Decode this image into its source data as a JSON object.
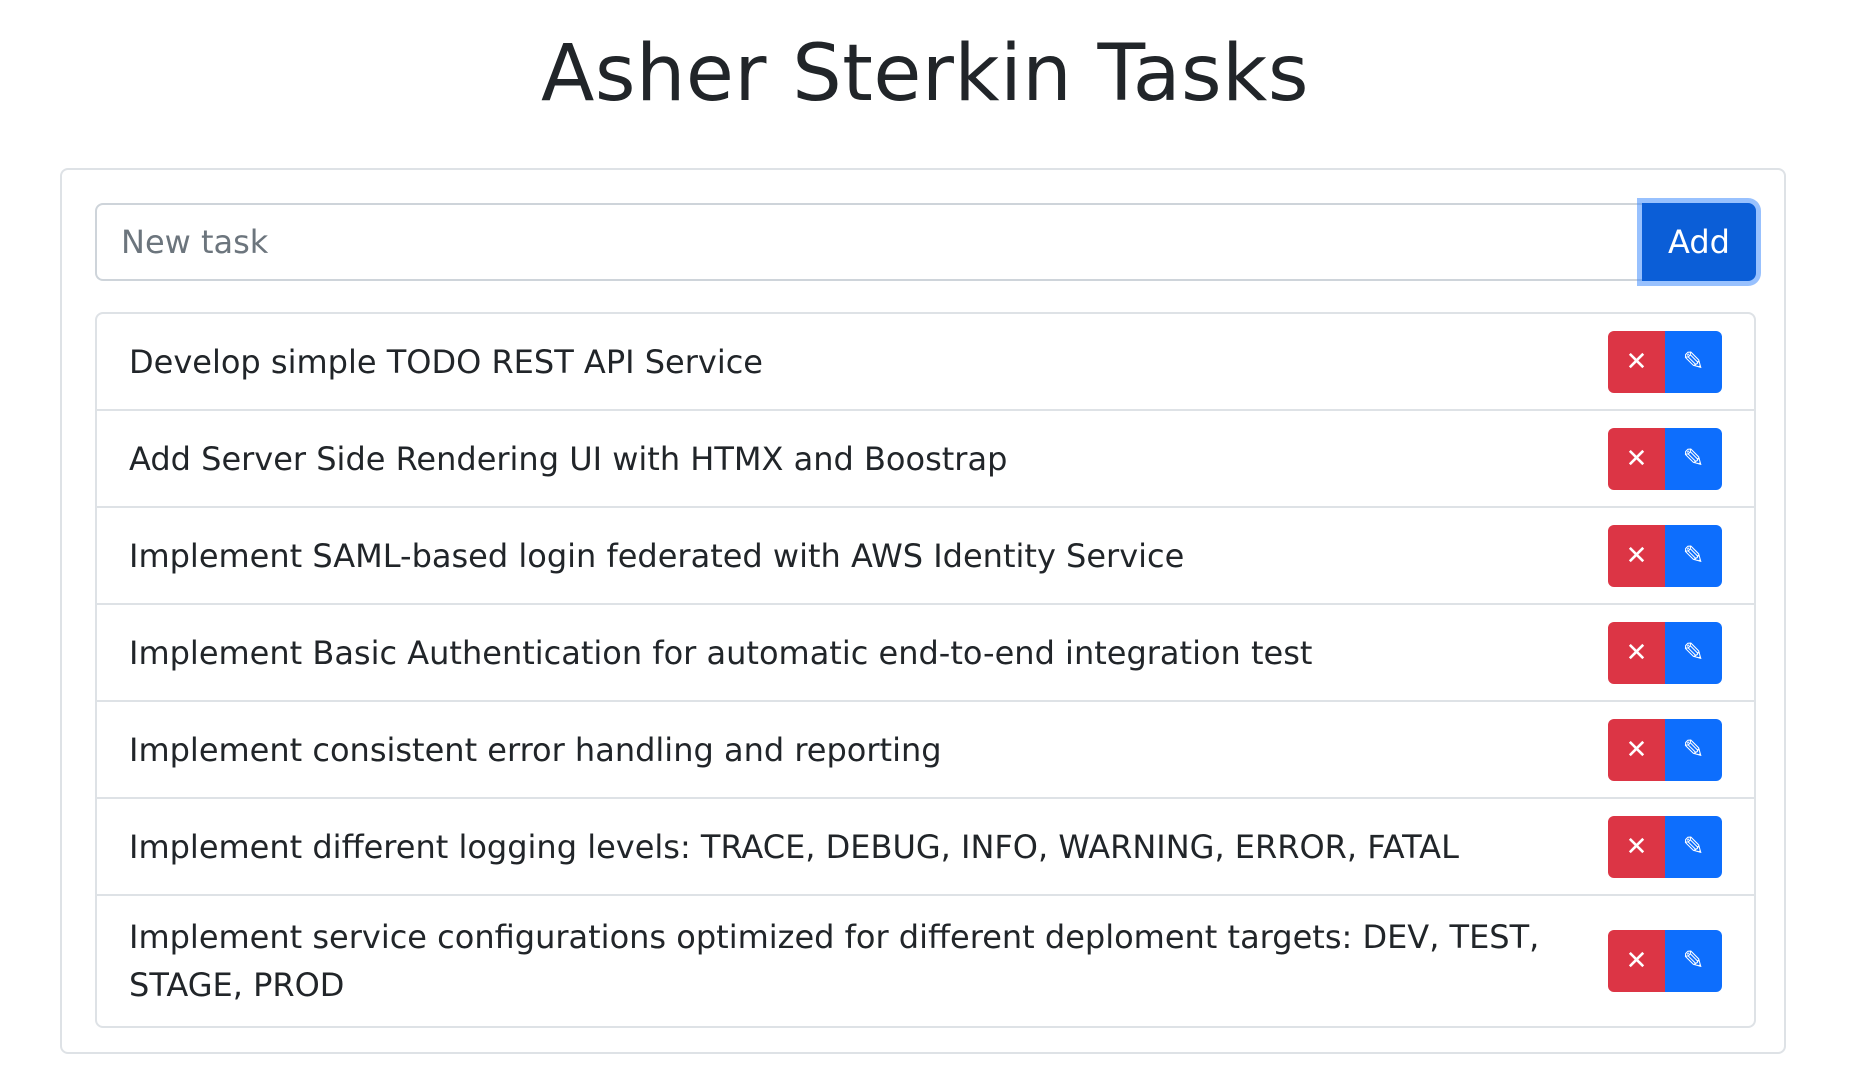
{
  "header": {
    "title": "Asher Sterkin Tasks"
  },
  "new_task": {
    "placeholder": "New task",
    "value": "",
    "add_label": "Add"
  },
  "buttons": {
    "delete_glyph": "✕",
    "edit_glyph": "✎"
  },
  "colors": {
    "delete": "#dc3545",
    "edit": "#0d6efd",
    "add": "#0b5ed7"
  },
  "tasks": [
    {
      "text": "Develop simple TODO REST API Service"
    },
    {
      "text": "Add Server Side Rendering UI with HTMX and Boostrap"
    },
    {
      "text": "Implement SAML-based login federated with AWS Identity Service"
    },
    {
      "text": "Implement Basic Authentication for automatic end-to-end integration test"
    },
    {
      "text": "Implement consistent error handling and reporting"
    },
    {
      "text": "Implement different logging levels: TRACE, DEBUG, INFO, WARNING, ERROR, FATAL"
    },
    {
      "text": "Implement service configurations optimized for different deploment targets: DEV, TEST, STAGE, PROD"
    }
  ]
}
